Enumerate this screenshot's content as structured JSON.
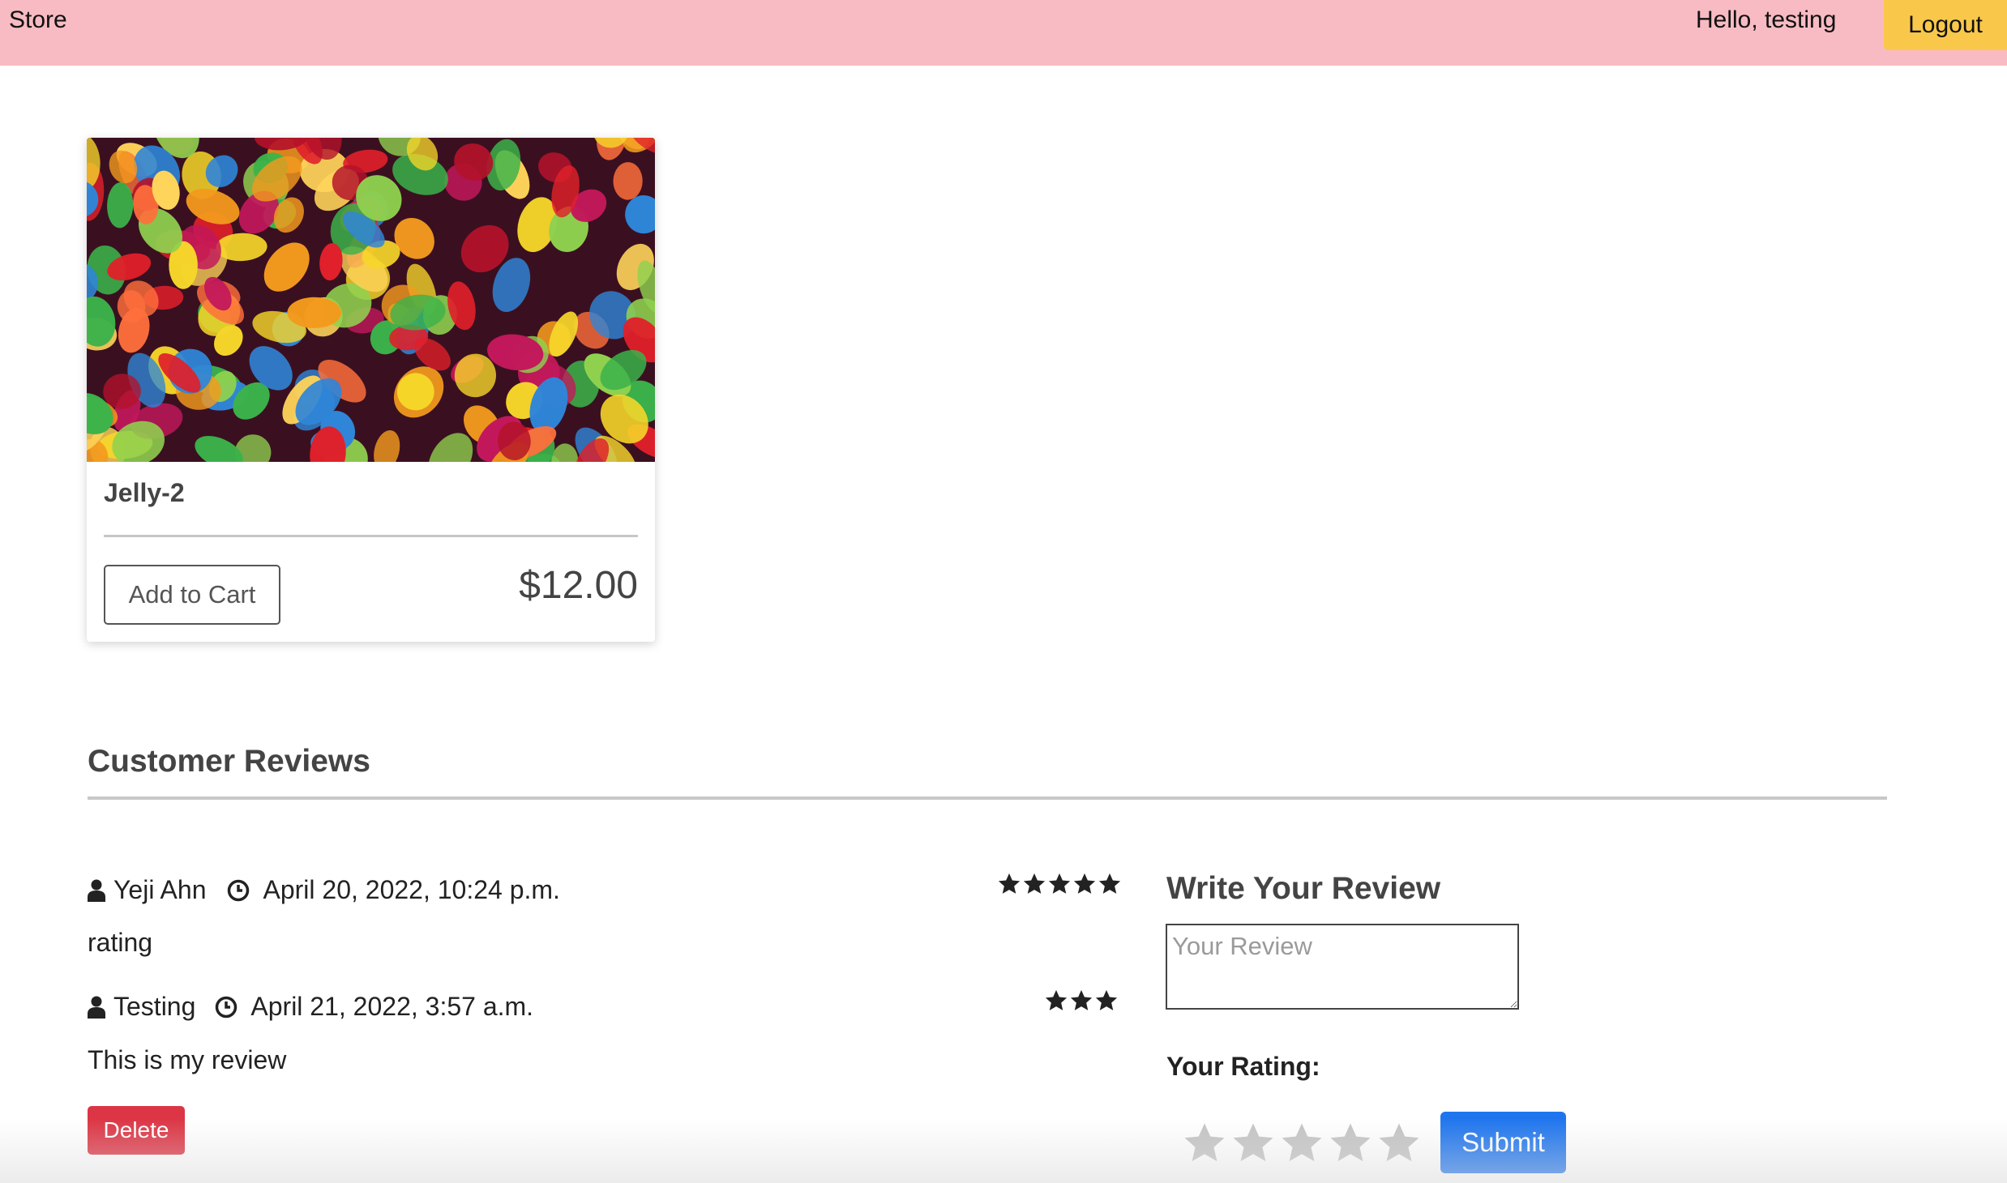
{
  "navbar": {
    "brand": "Store",
    "greeting": "Hello, testing",
    "logout_label": "Logout",
    "background_color": "#f8bbc3",
    "logout_color": "#f9c84a"
  },
  "product": {
    "image_icon": "gummy-bears-image",
    "name": "Jelly-2",
    "add_to_cart_label": "Add to Cart",
    "price": "$12.00"
  },
  "reviews": {
    "title": "Customer Reviews",
    "items": [
      {
        "author": "Yeji Ahn",
        "date": "April 20, 2022, 10:24 p.m.",
        "text": "rating",
        "rating": 5,
        "can_delete": false
      },
      {
        "author": "Testing",
        "date": "April 21, 2022, 3:57 a.m.",
        "text": "This is my review",
        "rating": 3,
        "can_delete": true,
        "delete_label": "Delete"
      }
    ]
  },
  "write_review": {
    "title": "Write Your Review",
    "placeholder": "Your Review",
    "value": "",
    "rating_label": "Your Rating:",
    "rating_value": 0,
    "max_rating": 5,
    "submit_label": "Submit",
    "submit_color": "#1f75ee"
  },
  "colors": {
    "delete": "#dc3545",
    "heading": "#444444"
  }
}
